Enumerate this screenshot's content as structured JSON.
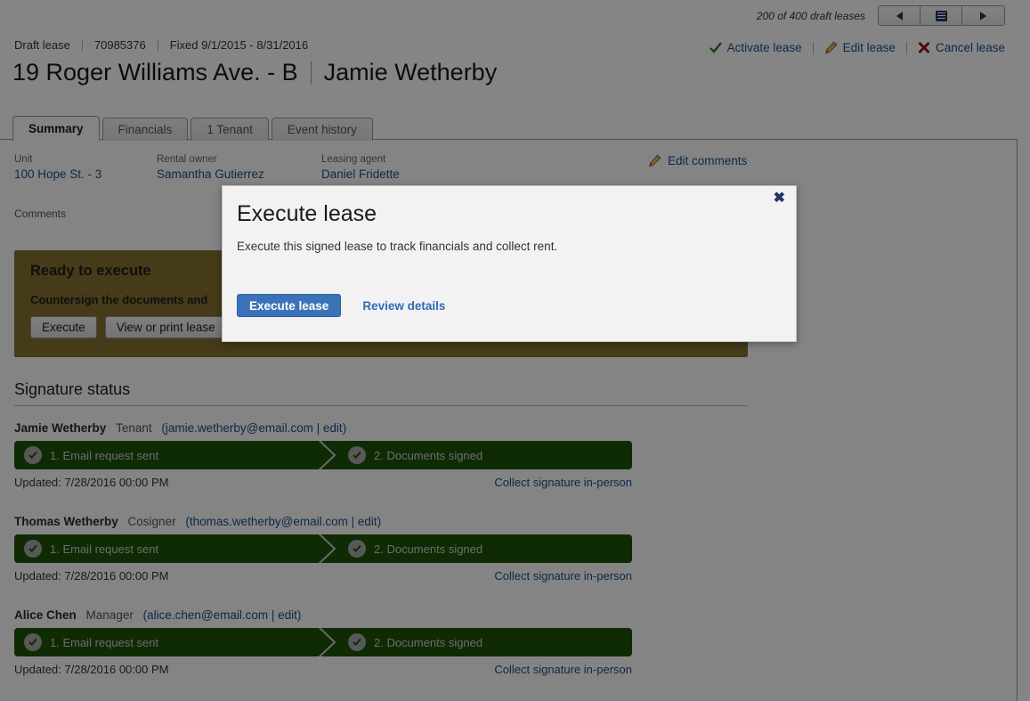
{
  "topbar": {
    "count_text": "200 of 400 draft leases",
    "prev_icon": "triangle-left-icon",
    "list_icon": "list-view-icon",
    "next_icon": "triangle-right-icon"
  },
  "breadcrumb": {
    "status": "Draft lease",
    "id": "70985376",
    "term": "Fixed 9/1/2015 - 8/31/2016"
  },
  "actions": [
    {
      "label": "Activate lease",
      "icon": "green-check-icon"
    },
    {
      "label": "Edit lease",
      "icon": "pencil-icon"
    },
    {
      "label": "Cancel lease",
      "icon": "red-x-icon"
    }
  ],
  "heading": {
    "address": "19 Roger Williams Ave. - B",
    "tenant": "Jamie Wetherby"
  },
  "tabs": [
    {
      "label": "Summary",
      "active": true
    },
    {
      "label": "Financials",
      "active": false
    },
    {
      "label": "1 Tenant",
      "active": false
    },
    {
      "label": "Event history",
      "active": false
    }
  ],
  "summary": {
    "fields": [
      {
        "label": "Unit",
        "value": "100 Hope St. - 3"
      },
      {
        "label": "Rental owner",
        "value": "Samantha Gutierrez"
      },
      {
        "label": "Leasing agent",
        "value": "Daniel Fridette"
      }
    ],
    "edit_comments_label": "Edit comments",
    "edit_comments_icon": "pencil-icon",
    "comments_label": "Comments"
  },
  "banner": {
    "title": "Ready to execute",
    "subtitle": "Countersign the documents and",
    "buttons": [
      {
        "label": "Execute"
      },
      {
        "label": "View or print lease"
      }
    ],
    "color": "#86712f"
  },
  "signature_status": {
    "heading": "Signature status",
    "people": [
      {
        "name": "Jamie Wetherby",
        "role": "Tenant",
        "email": "jamie.wetherby@email.com",
        "edit_label": "edit",
        "step1": "1. Email request sent",
        "step2": "2. Documents signed",
        "updated": "Updated: 7/28/2016 00:00 PM",
        "collect_label": "Collect signature in-person"
      },
      {
        "name": "Thomas Wetherby",
        "role": "Cosigner",
        "email": "thomas.wetherby@email.com",
        "edit_label": "edit",
        "step1": "1. Email request sent",
        "step2": "2. Documents signed",
        "updated": "Updated: 7/28/2016 00:00 PM",
        "collect_label": "Collect signature in-person"
      },
      {
        "name": "Alice Chen",
        "role": "Manager",
        "email": "alice.chen@email.com",
        "edit_label": "edit",
        "step1": "1. Email request sent",
        "step2": "2. Documents signed",
        "updated": "Updated: 7/28/2016 00:00 PM",
        "collect_label": "Collect signature in-person"
      }
    ],
    "bar_color": "#1d5406"
  },
  "modal": {
    "title": "Execute lease",
    "body": "Execute this signed lease to track financials and collect rent.",
    "primary_label": "Execute lease",
    "secondary_label": "Review details",
    "close_icon": "close-x-icon",
    "primary_color": "#3b73b9"
  }
}
